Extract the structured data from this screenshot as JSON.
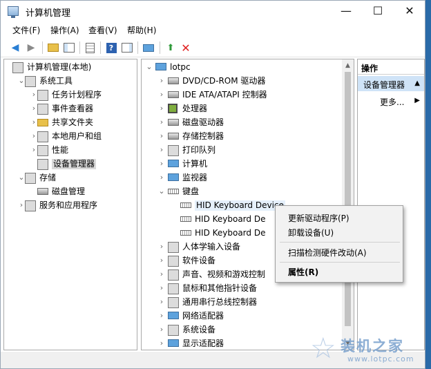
{
  "window": {
    "title": "计算机管理",
    "minimize": "—",
    "maximize": "☐",
    "close": "✕"
  },
  "menu": [
    "文件(F)",
    "操作(A)",
    "查看(V)",
    "帮助(H)"
  ],
  "left_tree": [
    {
      "label": "计算机管理(本地)",
      "level": 0,
      "icon": "computer-management-icon",
      "expand": ""
    },
    {
      "label": "系统工具",
      "level": 1,
      "icon": "tools-icon",
      "expand": "⌄"
    },
    {
      "label": "任务计划程序",
      "level": 2,
      "icon": "clock-icon",
      "expand": "›"
    },
    {
      "label": "事件查看器",
      "level": 2,
      "icon": "event-viewer-icon",
      "expand": "›"
    },
    {
      "label": "共享文件夹",
      "level": 2,
      "icon": "shared-folder-icon",
      "expand": "›"
    },
    {
      "label": "本地用户和组",
      "level": 2,
      "icon": "users-icon",
      "expand": "›"
    },
    {
      "label": "性能",
      "level": 2,
      "icon": "performance-icon",
      "expand": "›"
    },
    {
      "label": "设备管理器",
      "level": 2,
      "icon": "device-manager-icon",
      "expand": "",
      "selected": true
    },
    {
      "label": "存储",
      "level": 1,
      "icon": "storage-icon",
      "expand": "⌄"
    },
    {
      "label": "磁盘管理",
      "level": 2,
      "icon": "disk-management-icon",
      "expand": ""
    },
    {
      "label": "服务和应用程序",
      "level": 1,
      "icon": "services-icon",
      "expand": "›"
    }
  ],
  "device_tree": [
    {
      "label": "lotpc",
      "level": 0,
      "icon": "computer-icon",
      "expand": "⌄"
    },
    {
      "label": "DVD/CD-ROM 驱动器",
      "level": 1,
      "icon": "dvd-icon",
      "expand": "›"
    },
    {
      "label": "IDE ATA/ATAPI 控制器",
      "level": 1,
      "icon": "ide-controller-icon",
      "expand": "›"
    },
    {
      "label": "处理器",
      "level": 1,
      "icon": "processor-icon",
      "expand": "›"
    },
    {
      "label": "磁盘驱动器",
      "level": 1,
      "icon": "disk-drive-icon",
      "expand": "›"
    },
    {
      "label": "存储控制器",
      "level": 1,
      "icon": "storage-controller-icon",
      "expand": "›"
    },
    {
      "label": "打印队列",
      "level": 1,
      "icon": "printer-icon",
      "expand": "›"
    },
    {
      "label": "计算机",
      "level": 1,
      "icon": "computer-icon",
      "expand": "›"
    },
    {
      "label": "监视器",
      "level": 1,
      "icon": "monitor-icon",
      "expand": "›"
    },
    {
      "label": "键盘",
      "level": 1,
      "icon": "keyboard-icon",
      "expand": "⌄"
    },
    {
      "label": "HID Keyboard Device",
      "level": 2,
      "icon": "keyboard-icon",
      "expand": "",
      "highlight": true
    },
    {
      "label": "HID Keyboard De",
      "level": 2,
      "icon": "keyboard-icon",
      "expand": ""
    },
    {
      "label": "HID Keyboard De",
      "level": 2,
      "icon": "keyboard-icon",
      "expand": ""
    },
    {
      "label": "人体学输入设备",
      "level": 1,
      "icon": "hid-icon",
      "expand": "›"
    },
    {
      "label": "软件设备",
      "level": 1,
      "icon": "software-device-icon",
      "expand": "›"
    },
    {
      "label": "声音、视频和游戏控制",
      "level": 1,
      "icon": "sound-icon",
      "expand": "›"
    },
    {
      "label": "鼠标和其他指针设备",
      "level": 1,
      "icon": "mouse-icon",
      "expand": "›"
    },
    {
      "label": "通用串行总线控制器",
      "level": 1,
      "icon": "usb-icon",
      "expand": "›"
    },
    {
      "label": "网络适配器",
      "level": 1,
      "icon": "network-adapter-icon",
      "expand": "›"
    },
    {
      "label": "系统设备",
      "level": 1,
      "icon": "system-device-icon",
      "expand": "›"
    },
    {
      "label": "显示适配器",
      "level": 1,
      "icon": "display-adapter-icon",
      "expand": "›"
    }
  ],
  "actions": {
    "header": "操作",
    "item": "设备管理器",
    "more": "更多..."
  },
  "context_menu": {
    "update_driver": "更新驱动程序(P)",
    "uninstall": "卸载设备(U)",
    "scan": "扫描检测硬件改动(A)",
    "properties": "属性(R)"
  },
  "watermark": {
    "text": "装机之家",
    "url": "www.lotpc.com"
  },
  "colors": {
    "selection": "#d9d9d9",
    "action_highlight": "#cfe3f7",
    "delete_red": "#e02020"
  }
}
